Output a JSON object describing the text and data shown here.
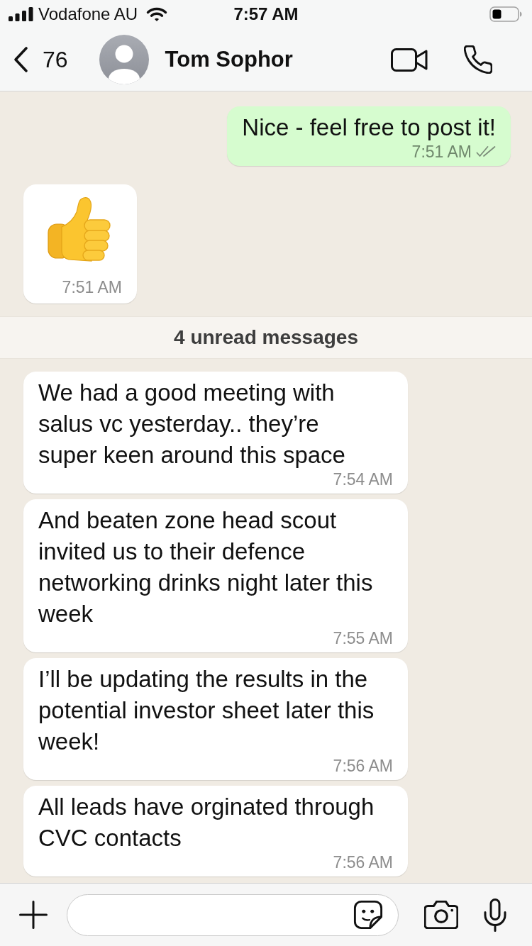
{
  "status_bar": {
    "carrier": "Vodafone AU",
    "time": "7:57 AM"
  },
  "header": {
    "back_count": "76",
    "contact_name": "Tom Sophor"
  },
  "messages": [
    {
      "kind": "text",
      "outgoing": true,
      "text": "Nice - feel free to post it!",
      "time": "7:51 AM",
      "delivered": true,
      "read": false
    },
    {
      "kind": "emoji",
      "outgoing": false,
      "time": "7:51 AM"
    },
    {
      "kind": "divider",
      "text": "4 unread messages"
    },
    {
      "kind": "text",
      "outgoing": false,
      "text": "We had a good meeting with salus vc yesterday.. they’re super keen around this space",
      "time": "7:54 AM"
    },
    {
      "kind": "text",
      "outgoing": false,
      "text": "And beaten zone head scout invited us to their defence networking drinks night later this week",
      "time": "7:55 AM"
    },
    {
      "kind": "text",
      "outgoing": false,
      "text": "I’ll be updating the results in the potential investor sheet later this week!",
      "time": "7:56 AM"
    },
    {
      "kind": "text",
      "outgoing": false,
      "text": "All leads have orginated through CVC contacts",
      "time": "7:56 AM"
    }
  ]
}
